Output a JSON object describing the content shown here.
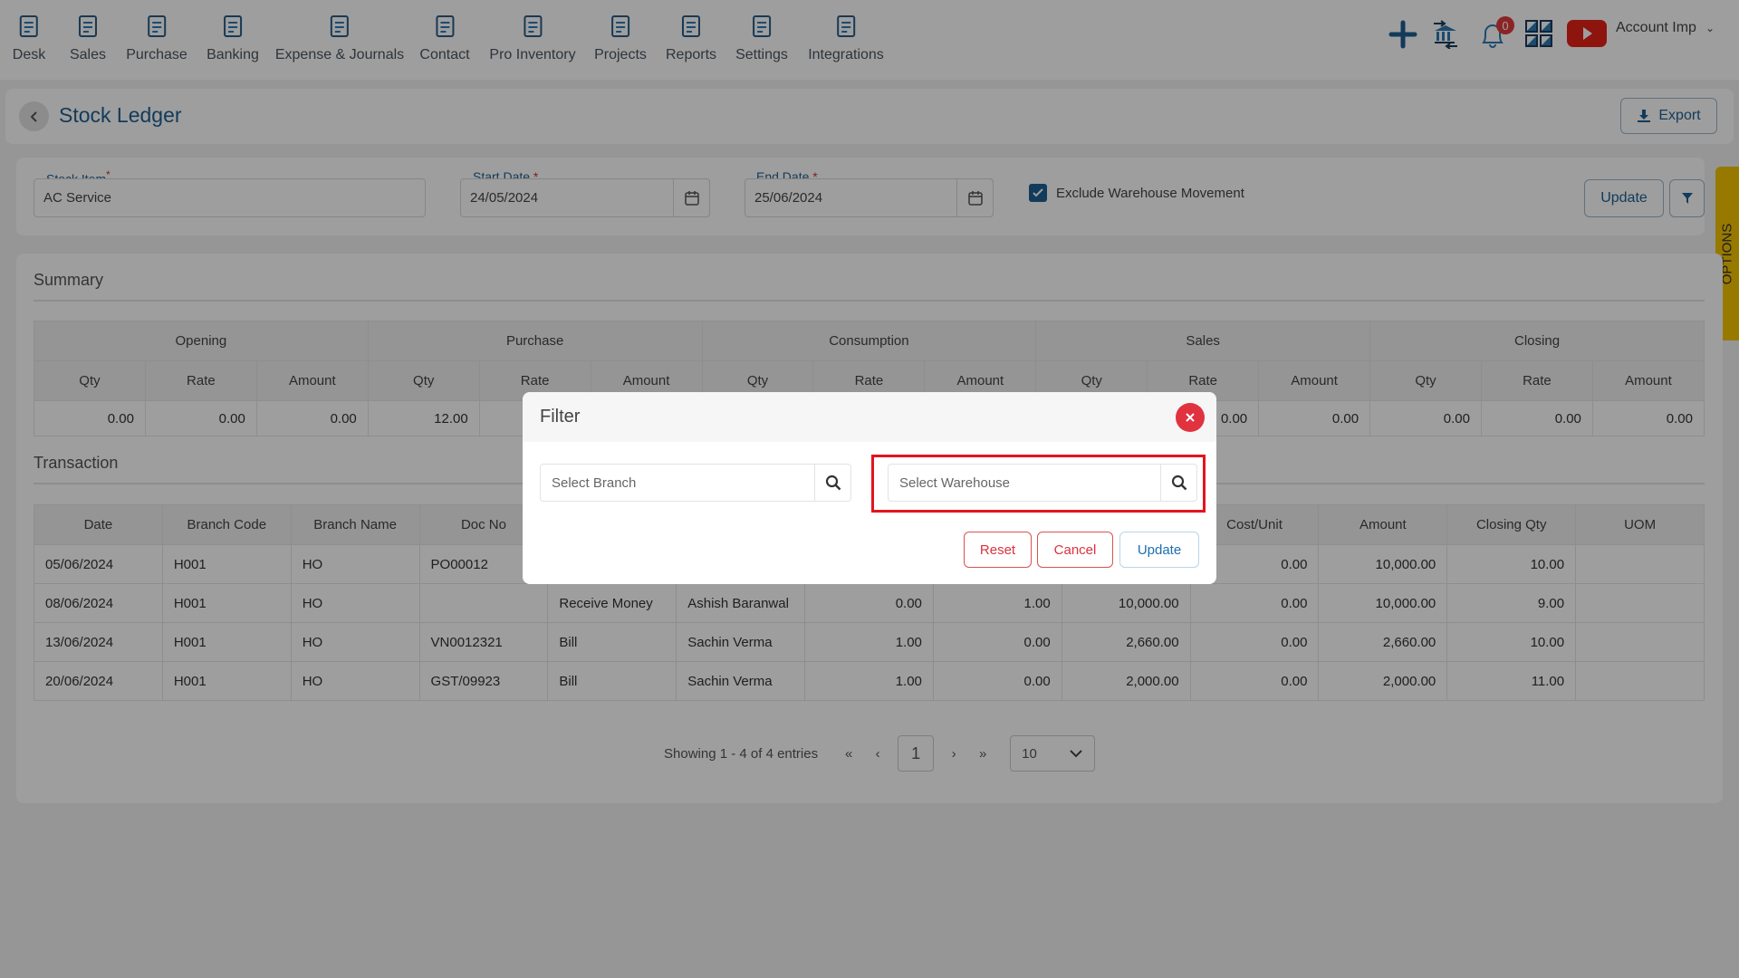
{
  "nav": {
    "items": [
      {
        "label": "Desk",
        "icon": "desk-icon"
      },
      {
        "label": "Sales",
        "icon": "sales-icon"
      },
      {
        "label": "Purchase",
        "icon": "cart-icon"
      },
      {
        "label": "Banking",
        "icon": "bank-icon"
      },
      {
        "label": "Expense & Journals",
        "icon": "journal-icon"
      },
      {
        "label": "Contact",
        "icon": "contact-icon"
      },
      {
        "label": "Pro Inventory",
        "icon": "inventory-icon"
      },
      {
        "label": "Projects",
        "icon": "projects-icon"
      },
      {
        "label": "Reports",
        "icon": "reports-icon"
      },
      {
        "label": "Settings",
        "icon": "settings-icon"
      },
      {
        "label": "Integrations",
        "icon": "integrations-icon"
      }
    ],
    "notification_count": "0",
    "account_label": "Account Imp"
  },
  "header": {
    "title": "Stock Ledger",
    "export_label": "Export"
  },
  "filters": {
    "stock_item_label": "Stock Item",
    "stock_item_value": "AC Service",
    "start_date_label": "Start Date",
    "start_date_value": "24/05/2024",
    "end_date_label": "End Date",
    "end_date_value": "25/06/2024",
    "exclude_label": "Exclude Warehouse Movement",
    "exclude_checked": true,
    "update_label": "Update",
    "options_label": "OPTIONS"
  },
  "summary": {
    "title": "Summary",
    "groups": [
      "Opening",
      "Purchase",
      "Consumption",
      "Sales",
      "Closing"
    ],
    "subheaders": [
      "Qty",
      "Rate",
      "Amount"
    ],
    "values": [
      "0.00",
      "0.00",
      "0.00",
      "12.00",
      "",
      "",
      "",
      "",
      "",
      "",
      "0.00",
      "0.00",
      "0.00",
      "0.00",
      "0.00"
    ]
  },
  "transaction": {
    "title": "Transaction",
    "headers": [
      "Date",
      "Branch Code",
      "Branch Name",
      "Doc No",
      "",
      "",
      "",
      "",
      "",
      "Cost/Unit",
      "Amount",
      "Closing Qty",
      "UOM"
    ],
    "rows": [
      [
        "05/06/2024",
        "H001",
        "HO",
        "PO00012",
        "",
        "",
        "",
        "",
        "",
        "0.00",
        "10,000.00",
        "10.00",
        ""
      ],
      [
        "08/06/2024",
        "H001",
        "HO",
        "",
        "Receive Money",
        "Ashish Baranwal",
        "0.00",
        "1.00",
        "10,000.00",
        "0.00",
        "10,000.00",
        "9.00",
        ""
      ],
      [
        "13/06/2024",
        "H001",
        "HO",
        "VN0012321",
        "Bill",
        "Sachin Verma",
        "1.00",
        "0.00",
        "2,660.00",
        "0.00",
        "2,660.00",
        "10.00",
        ""
      ],
      [
        "20/06/2024",
        "H001",
        "HO",
        "GST/09923",
        "Bill",
        "Sachin Verma",
        "1.00",
        "0.00",
        "2,000.00",
        "0.00",
        "2,000.00",
        "11.00",
        ""
      ]
    ],
    "numeric_columns": [
      6,
      7,
      8,
      9,
      10,
      11
    ]
  },
  "pagination": {
    "showing": "Showing 1 - 4 of 4 entries",
    "page": "1",
    "page_size": "10"
  },
  "modal": {
    "title": "Filter",
    "branch_placeholder": "Select Branch",
    "warehouse_placeholder": "Select Warehouse",
    "reset_label": "Reset",
    "cancel_label": "Cancel",
    "update_label": "Update"
  },
  "colors": {
    "primary": "#1d5f93",
    "danger": "#e0323f",
    "highlight": "#e3141f",
    "options_tab": "#f5c400",
    "youtube": "#e62117"
  }
}
